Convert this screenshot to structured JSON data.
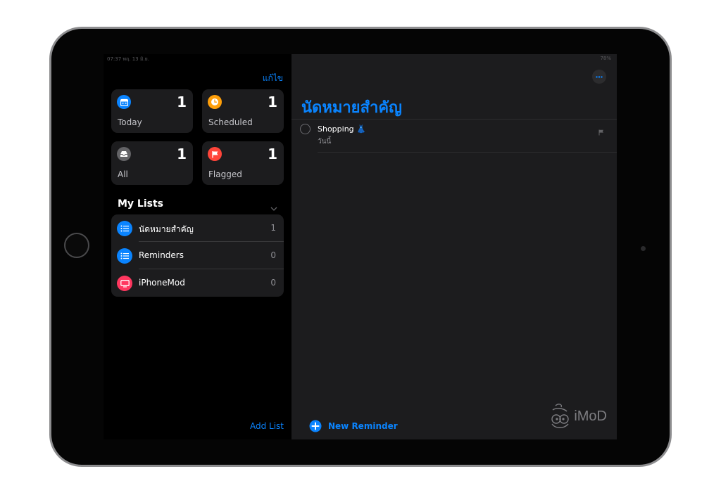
{
  "status_bar": {
    "time": "07:37  พฤ. 13 มิ.ย.",
    "battery": "78%"
  },
  "sidebar": {
    "edit_label": "แก้ไข",
    "smart_lists": [
      {
        "label": "Today",
        "count": "1",
        "icon": "calendar-icon",
        "color": "#0a84ff"
      },
      {
        "label": "Scheduled",
        "count": "1",
        "icon": "clock-icon",
        "color": "#ff9f0a"
      },
      {
        "label": "All",
        "count": "1",
        "icon": "tray-icon",
        "color": "#636366"
      },
      {
        "label": "Flagged",
        "count": "1",
        "icon": "flag-icon",
        "color": "#ff453a"
      }
    ],
    "my_lists_title": "My Lists",
    "lists": [
      {
        "label": "นัดหมายสำคัญ",
        "count": "1",
        "icon": "list-icon",
        "color": "#0a84ff"
      },
      {
        "label": "Reminders",
        "count": "0",
        "icon": "list-icon",
        "color": "#0a84ff"
      },
      {
        "label": "iPhoneMod",
        "count": "0",
        "icon": "tv-icon",
        "color": "#ff375f"
      }
    ],
    "add_list_label": "Add List"
  },
  "detail": {
    "title": "นัดหมายสำคัญ",
    "reminders": [
      {
        "title": "Shopping 👗",
        "subtitle": "วันนี้"
      }
    ],
    "new_reminder_label": "New Reminder",
    "watermark": "iMoD"
  },
  "colors": {
    "accent": "#0a84ff",
    "background": "#000000",
    "panel": "#1c1c1e"
  }
}
